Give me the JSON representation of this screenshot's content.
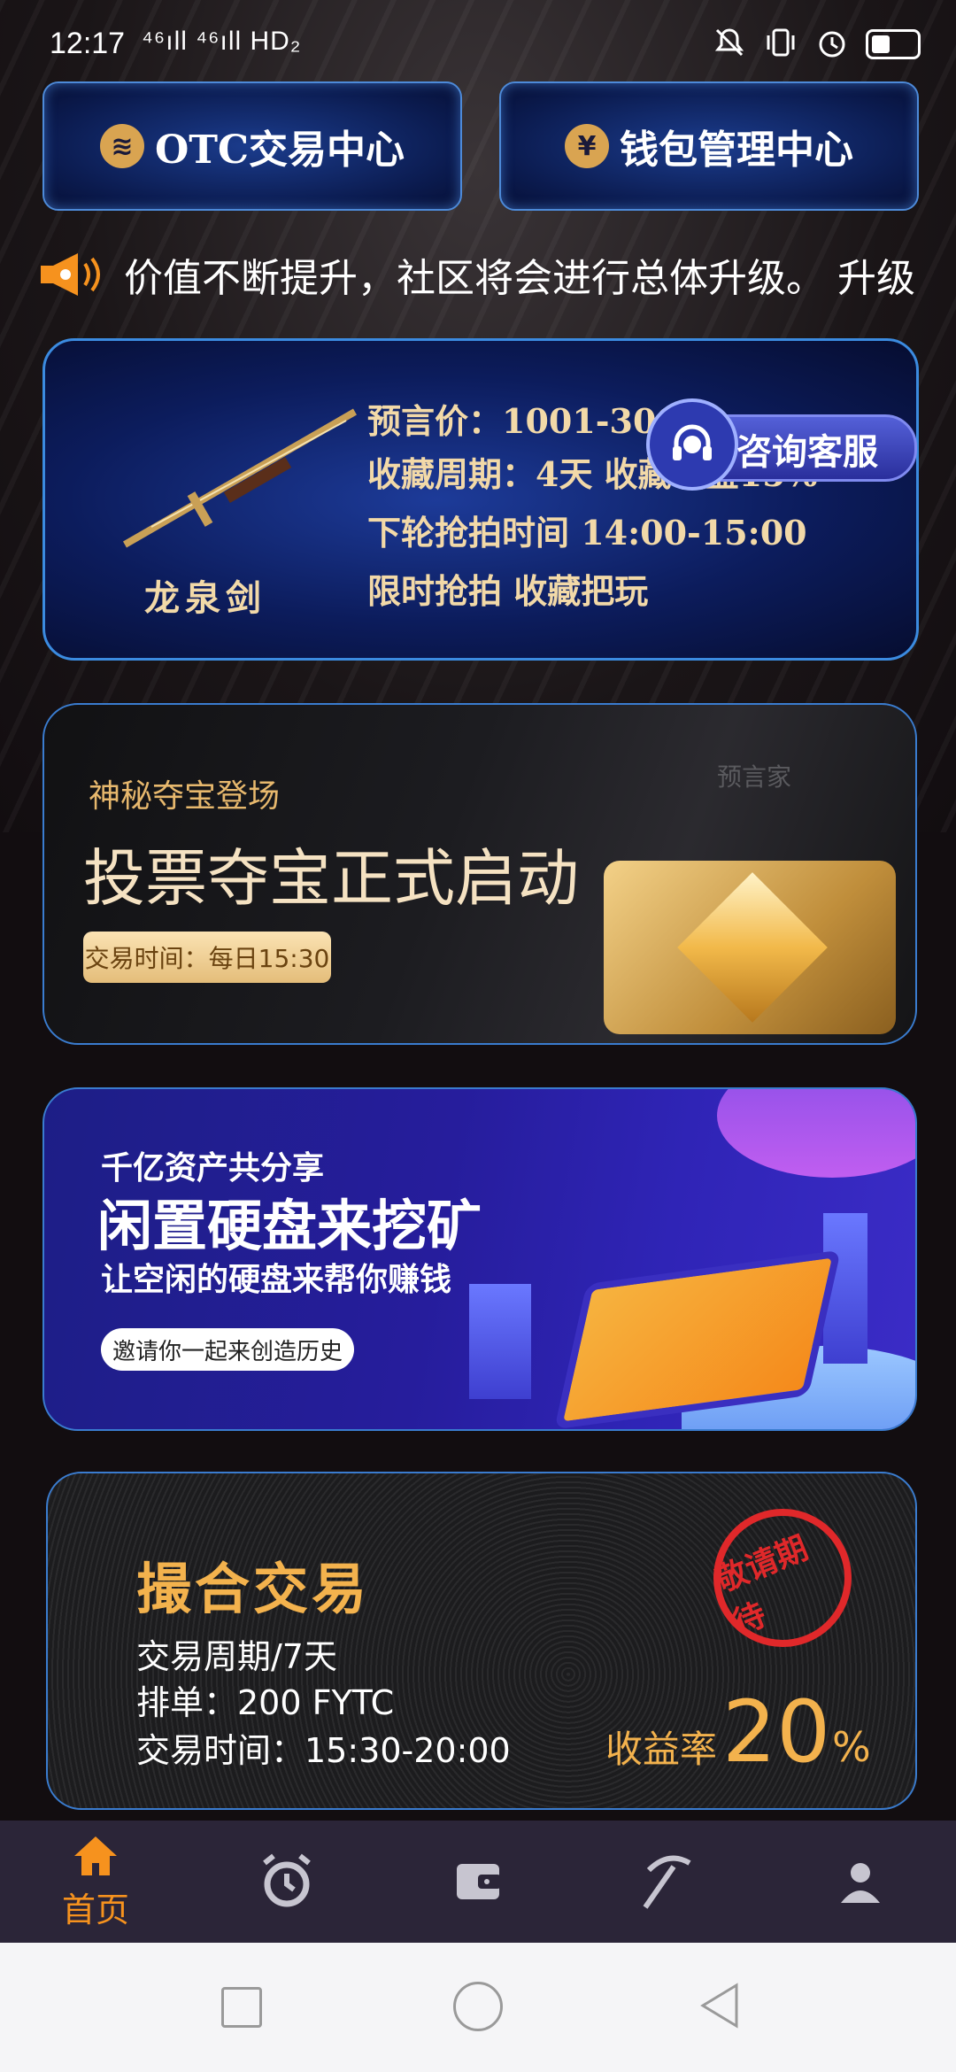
{
  "status": {
    "time": "12:17",
    "network": "⁴⁶ıll ⁴⁶ıll HD₂"
  },
  "top_buttons": [
    {
      "label": "OTC交易中心",
      "icon": "coins-icon"
    },
    {
      "label": "钱包管理中心",
      "icon": "yen-icon"
    }
  ],
  "notice": {
    "text": "价值不断提升，社区将会进行总体升级。 升级"
  },
  "sword_banner": {
    "line1": "预言价：1001-3000",
    "line2": "收藏周期：4天  收藏收益15%",
    "line3": "下轮抢拍时间 14:00-15:00",
    "line4": "限时抢拍 收藏把玩",
    "name": "龙泉剑"
  },
  "service_button": {
    "label": "咨询客服"
  },
  "vip_banner": {
    "subtitle": "神秘夺宝登场",
    "title": "投票夺宝正式启动",
    "tag": "交易时间：每日15:30",
    "badge": "预言家"
  },
  "mining_banner": {
    "line1": "千亿资产共分享",
    "line2": "闲置硬盘来挖矿",
    "line3": "让空闲的硬盘来帮你赚钱",
    "button": "邀请你一起来创造历史"
  },
  "match_banner": {
    "title": "撮合交易",
    "line1": "交易周期/7天",
    "line2": "排单：200 FYTC",
    "line3": "交易时间：15:30-20:00",
    "rate_label": "收益率",
    "rate_value": "20",
    "rate_unit": "%",
    "stamp": "敬请期待"
  },
  "bottom_nav": {
    "items": [
      {
        "name": "home",
        "label": "首页",
        "active": true
      },
      {
        "name": "clock",
        "label": ""
      },
      {
        "name": "wallet",
        "label": ""
      },
      {
        "name": "pickaxe",
        "label": ""
      },
      {
        "name": "profile",
        "label": ""
      }
    ],
    "active_color": "#f6921e"
  }
}
